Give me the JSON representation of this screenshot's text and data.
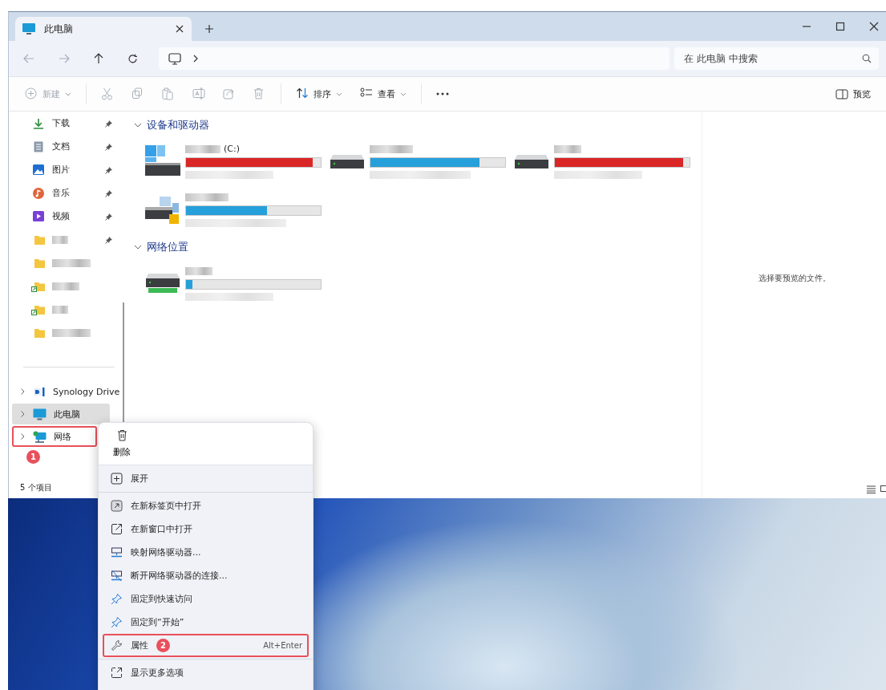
{
  "window": {
    "tab_title": "此电脑",
    "nav": {
      "back_disabled": true,
      "forward_disabled": true
    },
    "search": {
      "placeholder": "在 此电脑 中搜索"
    }
  },
  "toolbar": {
    "items": [
      {
        "kind": "new",
        "label": "新建",
        "disabled": true
      },
      {
        "kind": "cut",
        "disabled": true
      },
      {
        "kind": "copy",
        "disabled": true
      },
      {
        "kind": "paste",
        "disabled": true
      },
      {
        "kind": "rename",
        "disabled": true
      },
      {
        "kind": "share",
        "disabled": true
      },
      {
        "kind": "delete",
        "disabled": true
      },
      {
        "kind": "sort",
        "label": "排序",
        "disabled": false
      },
      {
        "kind": "view",
        "label": "查看",
        "disabled": false
      },
      {
        "kind": "more",
        "disabled": false
      }
    ],
    "preview_label": "预览"
  },
  "sidebar": {
    "quick_access": [
      {
        "kind": "download",
        "label": "下载",
        "pinned": true
      },
      {
        "kind": "document",
        "label": "文档",
        "pinned": true
      },
      {
        "kind": "picture",
        "label": "图片",
        "pinned": true
      },
      {
        "kind": "music",
        "label": "音乐",
        "pinned": true
      },
      {
        "kind": "video",
        "label": "视频",
        "pinned": true
      },
      {
        "kind": "folder",
        "pinned": true,
        "shared": false
      },
      {
        "kind": "folder",
        "pinned": false,
        "shared": false
      },
      {
        "kind": "folder",
        "pinned": false,
        "shared": true
      },
      {
        "kind": "folder",
        "pinned": false,
        "shared": true
      },
      {
        "kind": "folder",
        "pinned": false,
        "shared": false
      }
    ],
    "tree": [
      {
        "kind": "synology",
        "label": "Synology Drive",
        "selected": false,
        "highlighted": false
      },
      {
        "kind": "computer",
        "label": "此电脑",
        "selected": true,
        "highlighted": false
      },
      {
        "kind": "network",
        "label": "网络",
        "selected": false,
        "highlighted": true,
        "badge": "1"
      }
    ]
  },
  "sections": [
    {
      "title": "设备和驱动器",
      "expanded": true,
      "drives": [
        {
          "kind": "system",
          "label": "(C:)",
          "level": 0.94,
          "low_space": true
        },
        {
          "kind": "hdd",
          "level": 0.81,
          "low_space": false
        },
        {
          "kind": "hdd",
          "level": 0.95,
          "low_space": true
        },
        {
          "kind": "removable",
          "level": 0.6,
          "low_space": false
        }
      ]
    },
    {
      "title": "网络位置",
      "expanded": true,
      "drives": [
        {
          "kind": "network",
          "level": 0.05,
          "low_space": false
        }
      ]
    }
  ],
  "preview_pane": {
    "message": "选择要预览的文件。"
  },
  "status_bar": {
    "item_count": "5 个项目"
  },
  "context_menu": {
    "top_actions": [
      {
        "kind": "delete",
        "label": "删除"
      }
    ],
    "groups": [
      [
        {
          "kind": "expand",
          "label": "展开"
        }
      ],
      [
        {
          "kind": "open-tab",
          "label": "在新标签页中打开"
        },
        {
          "kind": "open-window",
          "label": "在新窗口中打开"
        },
        {
          "kind": "map-drive",
          "label": "映射网络驱动器..."
        },
        {
          "kind": "disconnect-drive",
          "label": "断开网络驱动器的连接..."
        },
        {
          "kind": "pin",
          "label": "固定到快速访问"
        },
        {
          "kind": "pin",
          "label": "固定到“开始”"
        },
        {
          "kind": "properties",
          "label": "属性",
          "shortcut": "Alt+Enter",
          "highlighted": true,
          "badge": "2"
        }
      ],
      [
        {
          "kind": "more-options",
          "label": "显示更多选项"
        }
      ]
    ]
  }
}
